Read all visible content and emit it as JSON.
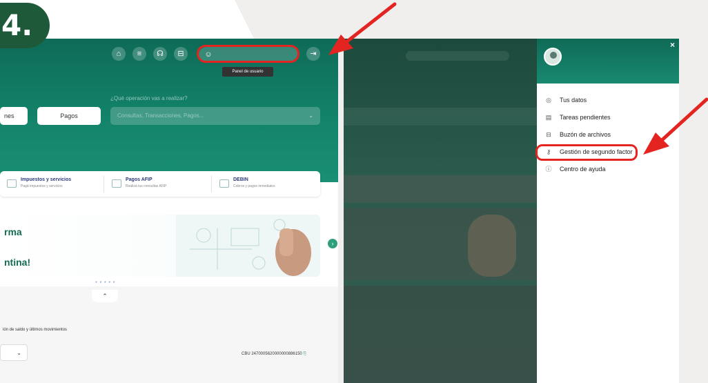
{
  "step": {
    "label": "4."
  },
  "left_screen": {
    "nav_icons": [
      "home-icon",
      "menu-icon",
      "headset-icon",
      "inbox-icon"
    ],
    "user_panel_icon": "user-circle-icon",
    "logout_icon": "logout-icon",
    "tooltip": "Panel de usuario",
    "question": "¿Qué operación vas a realizar?",
    "buttons": {
      "left": "nes",
      "right": "Pagos"
    },
    "search_placeholder": "Consultas, Transacciones, Pagos...",
    "cards": [
      {
        "title": "Impuestos y servicios",
        "sub": "Pagá impuestos y servicios"
      },
      {
        "title": "Pagos AFIP",
        "sub": "Realizá tus consultas AFIP"
      },
      {
        "title": "DEBIN",
        "sub": "Cobros y pagos inmediatos"
      }
    ],
    "banner": {
      "line1": "rma",
      "line2": "ntina!"
    },
    "balance_text": "ión de saldo y últimos movimientos",
    "cbu": "CBU 2470005620000000886150"
  },
  "right_screen": {
    "menu": [
      {
        "label": "Tus datos",
        "icon": "user-icon"
      },
      {
        "label": "Tareas pendientes",
        "icon": "clipboard-icon"
      },
      {
        "label": "Buzón de archivos",
        "icon": "inbox-icon"
      },
      {
        "label": "Gestión de segundo factor",
        "icon": "key-icon"
      },
      {
        "label": "Centro de ayuda",
        "icon": "help-icon"
      }
    ]
  },
  "colors": {
    "brand": "#13836a",
    "arrow": "#e32420",
    "step": "#1e5a3a"
  }
}
